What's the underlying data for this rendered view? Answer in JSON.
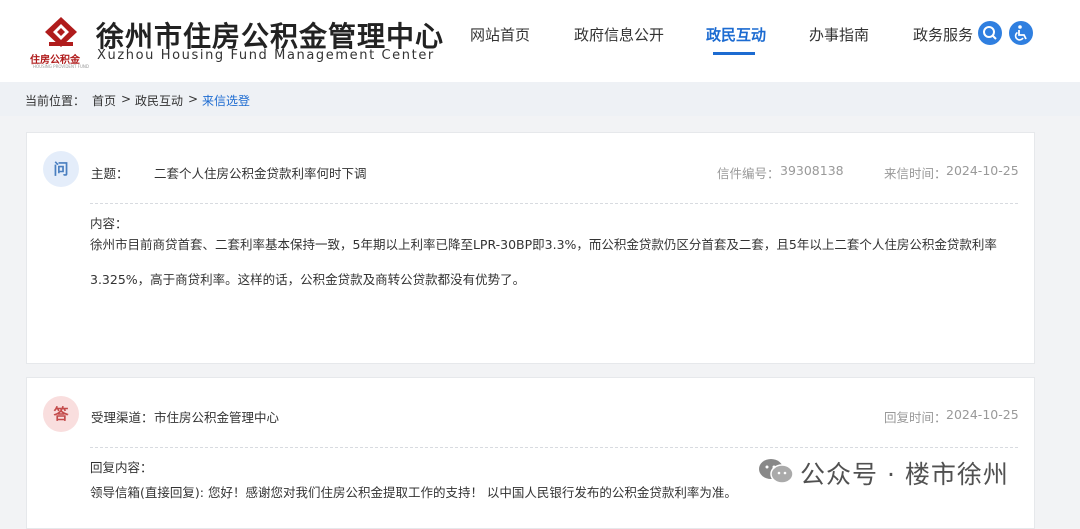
{
  "header": {
    "logo_cn": "徐州市住房公积金管理中心",
    "logo_en": "Xuzhou Housing Fund Management Center",
    "logo_small": "住房公积金",
    "logo_tiny": "HOUSING PROVIDENT FUND",
    "brand_color": "#b01c1c",
    "nav": [
      {
        "label": "网站首页"
      },
      {
        "label": "政府信息公开"
      },
      {
        "label": "政民互动",
        "active": true
      },
      {
        "label": "办事指南"
      },
      {
        "label": "政务服务"
      }
    ],
    "icons": [
      "search-icon",
      "accessibility-icon"
    ],
    "accent_color": "#1c6bd1"
  },
  "breadcrumb": {
    "prefix": "当前位置：",
    "items": [
      "首页",
      "政民互动",
      "来信选登"
    ],
    "separator": ">"
  },
  "question": {
    "badge": "问",
    "subject_label": "主题：",
    "subject": "二套个人住房公积金贷款利率何时下调",
    "letter_no_label": "信件编号：",
    "letter_no": "39308138",
    "date_label": "来信时间：",
    "date": "2024-10-25",
    "content_label": "内容：",
    "content_line1": "徐州市目前商贷首套、二套利率基本保持一致，5年期以上利率已降至LPR-30BP即3.3%，而公积金贷款仍区分首套及二套，且5年以上二套个人住房公积金贷款利率",
    "content_line2": "3.325%，高于商贷利率。这样的话，公积金贷款及商转公贷款都没有优势了。"
  },
  "answer": {
    "badge": "答",
    "channel_label": "受理渠道：",
    "channel": "市住房公积金管理中心",
    "date_label": "回复时间：",
    "date": "2024-10-25",
    "content_label": "回复内容：",
    "content_line1": "领导信箱(直接回复): 您好！感谢您对我们住房公积金提取工作的支持！ 以中国人民银行发布的公积金贷款利率为准。"
  },
  "watermark": {
    "text": "公众号 · 楼市徐州",
    "icon": "wechat-icon"
  }
}
